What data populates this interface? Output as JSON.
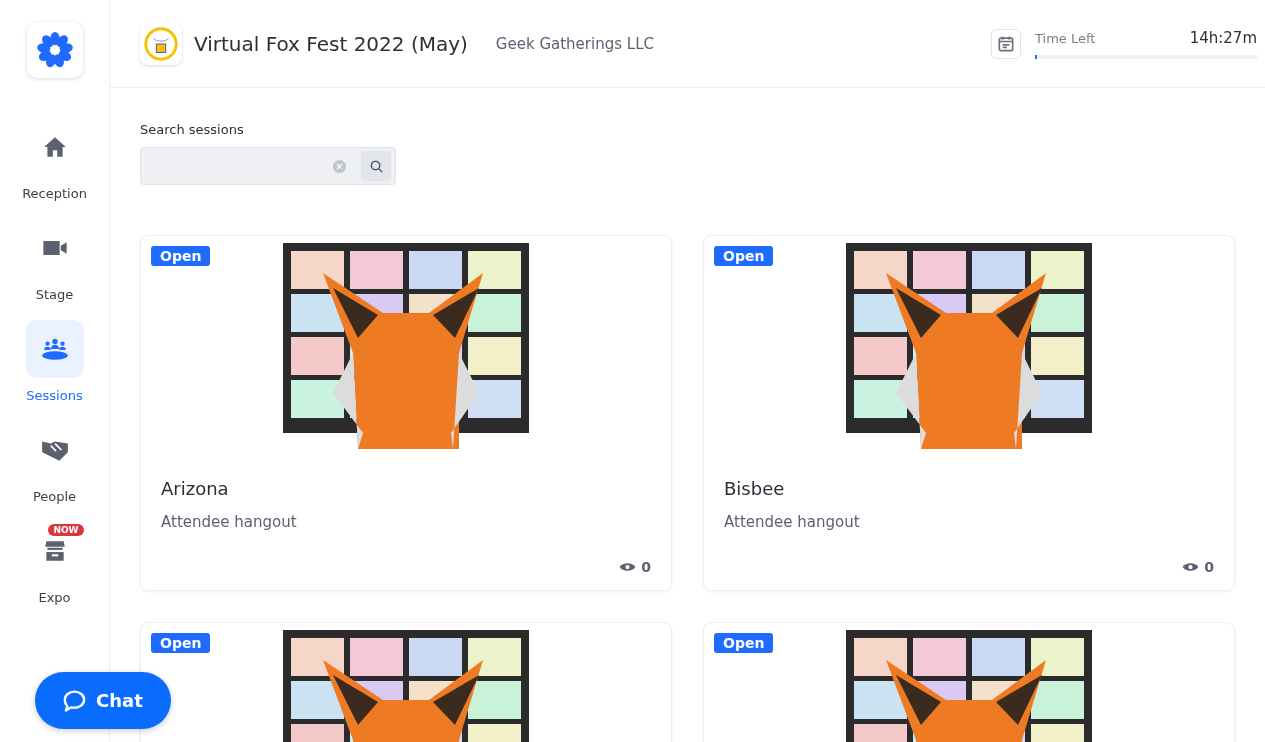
{
  "header": {
    "event_title": "Virtual Fox Fest 2022 (May)",
    "organizer": "Geek Gatherings LLC",
    "time_left": {
      "label": "Time Left",
      "value": "14h:27m",
      "level": 0.01
    }
  },
  "nav": [
    {
      "label": "Reception",
      "selected": false
    },
    {
      "label": "Stage",
      "selected": false
    },
    {
      "label": "Sessions",
      "selected": true
    },
    {
      "label": "People",
      "selected": false
    },
    {
      "label": "Expo",
      "selected": false,
      "badge": "NOW"
    }
  ],
  "search": {
    "label": "Search sessions"
  },
  "sessions": [
    {
      "status": "Open",
      "title": "Arizona",
      "description": "Attendee hangout",
      "viewers": "0"
    },
    {
      "status": "Open",
      "title": "Bisbee",
      "description": "Attendee hangout",
      "viewers": "0"
    },
    {
      "status": "Open"
    },
    {
      "status": "Open"
    }
  ],
  "chat_button": "Chat"
}
